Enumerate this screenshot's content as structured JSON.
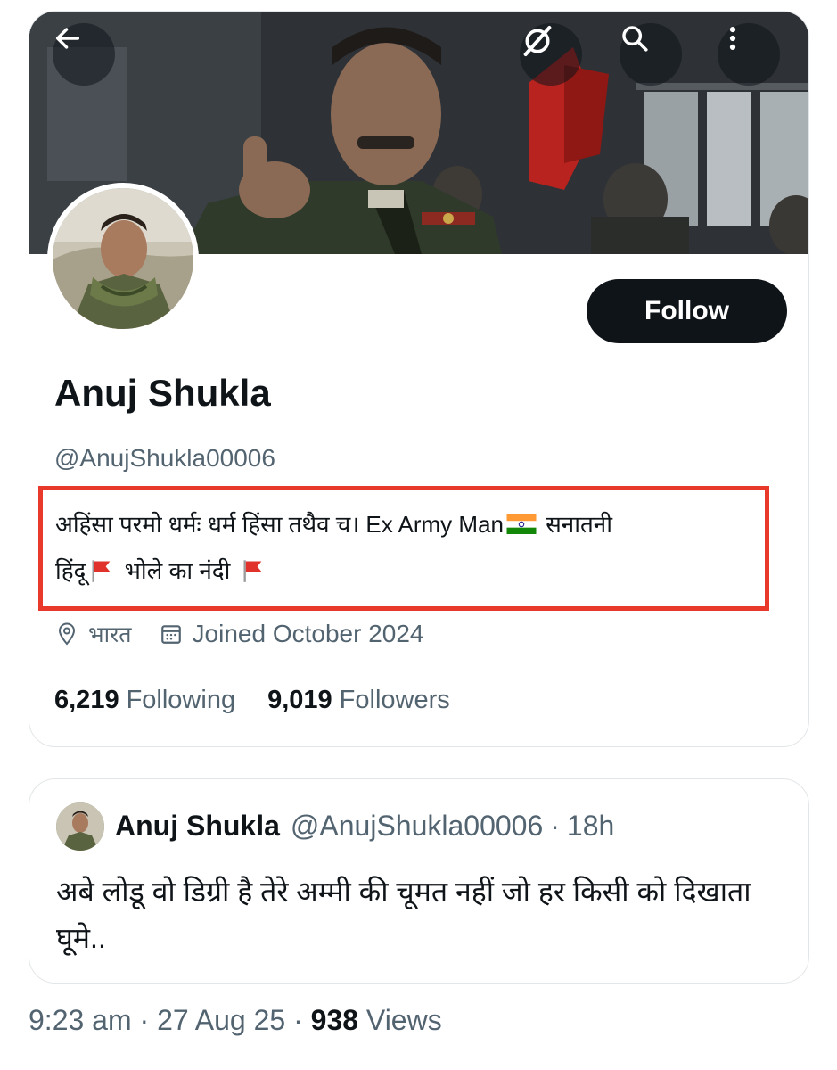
{
  "profile": {
    "display_name": "Anuj Shukla",
    "handle": "@AnujShukla00006",
    "follow_label": "Follow",
    "bio_part1": "अहिंसा परमो धर्मः धर्म हिंसा तथैव च। Ex Army Man",
    "bio_part2": " सनातनी",
    "bio_part3": "हिंदू",
    "bio_part4": " भोले का नंदी ",
    "location": "भारत",
    "joined": "Joined October 2024",
    "following_count": "6,219",
    "following_label": "Following",
    "followers_count": "9,019",
    "followers_label": "Followers"
  },
  "header_icons": {
    "back": "back-arrow-icon",
    "grok": "grok-icon",
    "search": "search-icon",
    "more": "more-vertical-icon"
  },
  "tweet": {
    "name": "Anuj Shukla",
    "handle": "@AnujShukla00006",
    "separator": "·",
    "time": "18h",
    "text": "अबे लोडू वो डिग्री है तेरे अम्मी की चूमत नहीं जो हर किसी को दिखाता घूमे.."
  },
  "footer": {
    "time_date": "9:23 am · 27 Aug 25 · ",
    "views_count": "938",
    "views_label": " Views"
  },
  "colors": {
    "text_primary": "#0f1419",
    "text_secondary": "#536471",
    "highlight_border": "#e8392a",
    "flag_red": "#e0312b"
  }
}
